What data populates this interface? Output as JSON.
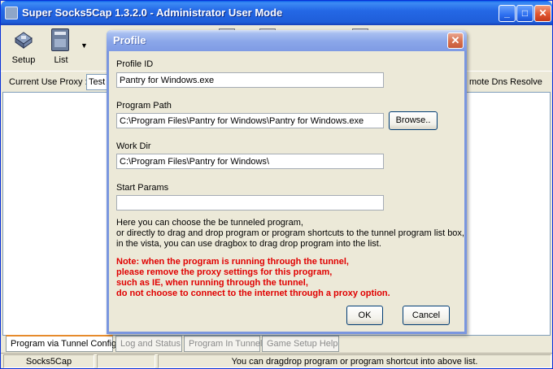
{
  "app": {
    "title": "Super Socks5Cap 1.3.2.0 - Administrator User Mode"
  },
  "toolbar": {
    "setup_label": "Setup",
    "list_label": "List"
  },
  "proxy_bar": {
    "label": "Current Use Proxy :",
    "selected": "Test",
    "remote_dns": "mote Dns Resolve"
  },
  "tabs": [
    {
      "label": "Program via Tunnel Config",
      "active": true
    },
    {
      "label": "Log and Status",
      "active": false
    },
    {
      "label": "Program In Tunnel",
      "active": false
    },
    {
      "label": "Game Setup Help",
      "active": false
    }
  ],
  "statusbar": {
    "app_name": "Socks5Cap",
    "middle": "",
    "message": "You can dragdrop program or program shortcut into above list."
  },
  "dialog": {
    "title": "Profile",
    "close_glyph": "✕",
    "profile_id_label": "Profile ID",
    "profile_id_value": "Pantry for Windows.exe",
    "program_path_label": "Program Path",
    "program_path_value": "C:\\Program Files\\Pantry for Windows\\Pantry for Windows.exe",
    "browse_label": "Browse..",
    "work_dir_label": "Work Dir",
    "work_dir_value": "C:\\Program Files\\Pantry for Windows\\",
    "start_params_label": "Start Params",
    "start_params_value": "",
    "help_lines": [
      "Here you can choose the be tunneled program,",
      "or directly to drag and drop program or program shortcuts to the tunnel program list box,",
      "in the vista, you can use dragbox to drag drop program into the list."
    ],
    "note_lines": [
      "Note:  when the program is running through the tunnel,",
      "please remove the proxy settings for this program,",
      "such as IE, when running through the tunnel,",
      "do not choose to connect to the internet through a proxy option."
    ],
    "ok_label": "OK",
    "cancel_label": "Cancel"
  },
  "colors": {
    "title_bar": "#2468e6",
    "dialog_title": "#8aa6e9",
    "note_red": "#e00000",
    "active_tab_accent": "#e68b2c"
  }
}
